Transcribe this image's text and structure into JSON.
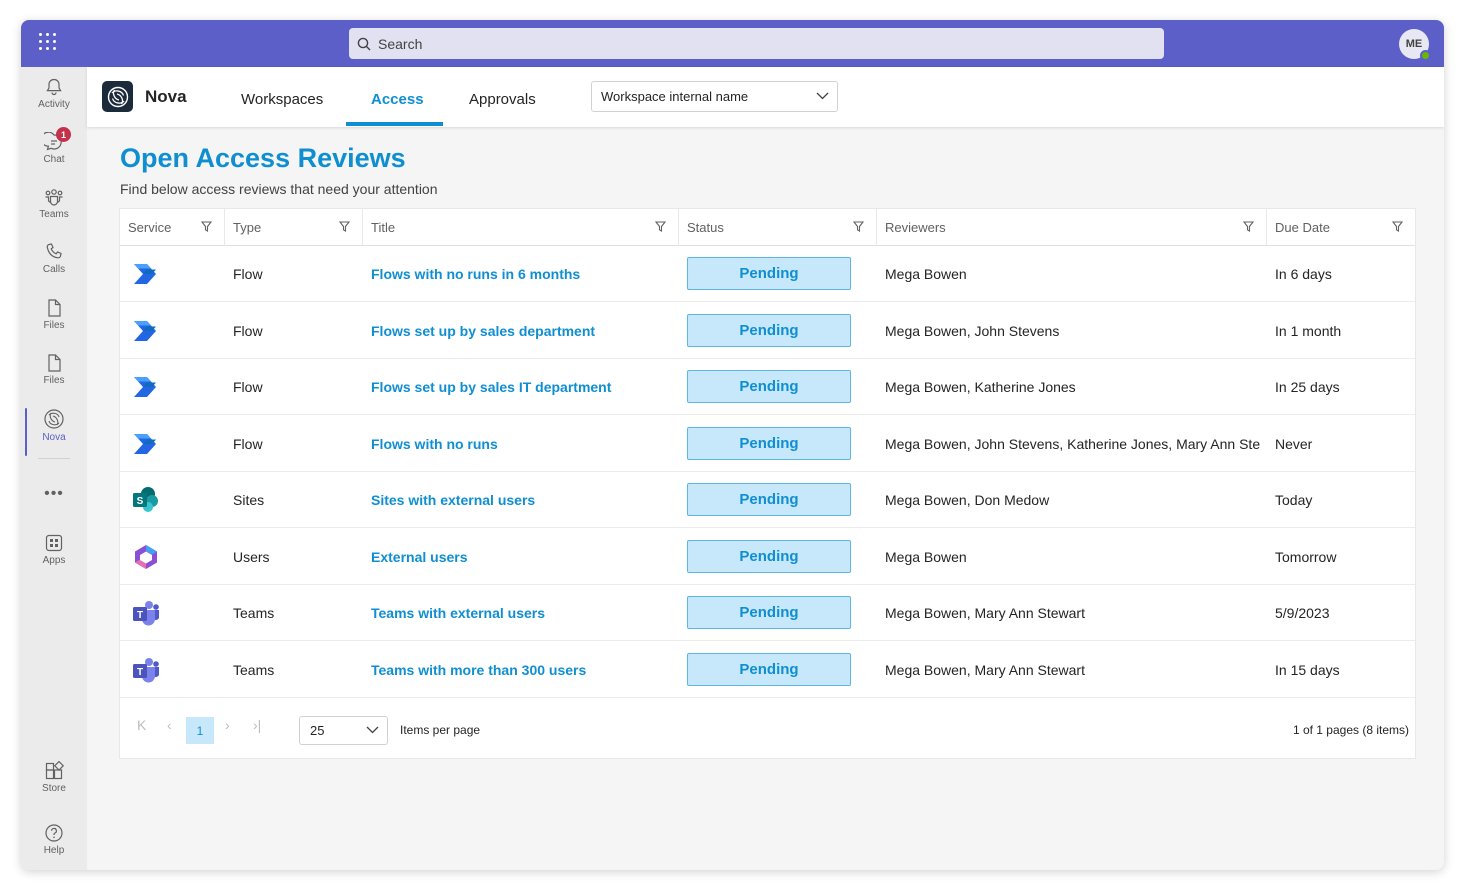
{
  "search": {
    "placeholder": "Search"
  },
  "user": {
    "initials": "ME"
  },
  "rail": {
    "items": [
      {
        "label": "Activity",
        "icon": "bell-icon"
      },
      {
        "label": "Chat",
        "icon": "chat-icon",
        "badge": "1"
      },
      {
        "label": "Teams",
        "icon": "teams-icon"
      },
      {
        "label": "Calls",
        "icon": "phone-icon"
      },
      {
        "label": "Files",
        "icon": "file-icon"
      },
      {
        "label": "Files",
        "icon": "file-icon"
      },
      {
        "label": "Nova",
        "icon": "nova-icon"
      }
    ],
    "more": "•••",
    "apps": "Apps",
    "store": "Store",
    "help": "Help"
  },
  "app": {
    "name": "Nova",
    "tabs": [
      "Workspaces",
      "Access",
      "Approvals"
    ],
    "active_tab": "Access",
    "workspace_select": "Workspace internal name"
  },
  "page": {
    "title": "Open Access Reviews",
    "subtitle": "Find below access reviews that need your attention"
  },
  "grid": {
    "columns": [
      "Service",
      "Type",
      "Title",
      "Status",
      "Reviewers",
      "Due Date"
    ],
    "rows": [
      {
        "service": "power-automate",
        "type": "Flow",
        "title": "Flows with no runs in 6 months",
        "status": "Pending",
        "reviewers": "Mega Bowen",
        "due": "In 6 days"
      },
      {
        "service": "power-automate",
        "type": "Flow",
        "title": "Flows set up by sales department",
        "status": "Pending",
        "reviewers": "Mega Bowen, John Stevens",
        "due": "In 1 month"
      },
      {
        "service": "power-automate",
        "type": "Flow",
        "title": "Flows set up by sales IT department",
        "status": "Pending",
        "reviewers": "Mega Bowen, Katherine Jones",
        "due": "In 25 days"
      },
      {
        "service": "power-automate",
        "type": "Flow",
        "title": "Flows with no runs",
        "status": "Pending",
        "reviewers": "Mega Bowen, John Stevens, Katherine Jones, Mary Ann Ste...",
        "due": "Never"
      },
      {
        "service": "sharepoint",
        "type": "Sites",
        "title": "Sites with external users",
        "status": "Pending",
        "reviewers": "Mega Bowen, Don Medow",
        "due": "Today"
      },
      {
        "service": "microsoft-365",
        "type": "Users",
        "title": "External users",
        "status": "Pending",
        "reviewers": "Mega Bowen",
        "due": "Tomorrow"
      },
      {
        "service": "teams",
        "type": "Teams",
        "title": "Teams with external users",
        "status": "Pending",
        "reviewers": "Mega Bowen, Mary Ann Stewart",
        "due": "5/9/2023"
      },
      {
        "service": "teams",
        "type": "Teams",
        "title": "Teams with more than 300 users",
        "status": "Pending",
        "reviewers": "Mega Bowen, Mary Ann Stewart",
        "due": "In 15 days"
      }
    ]
  },
  "pager": {
    "current_page": "1",
    "page_size": "25",
    "page_size_label": "Items per page",
    "info": "1 of 1 pages (8 items)"
  },
  "colors": {
    "teams_purple": "#5b5fc7",
    "accent": "#0f8fd1",
    "pending_bg": "#c7e7fa"
  }
}
